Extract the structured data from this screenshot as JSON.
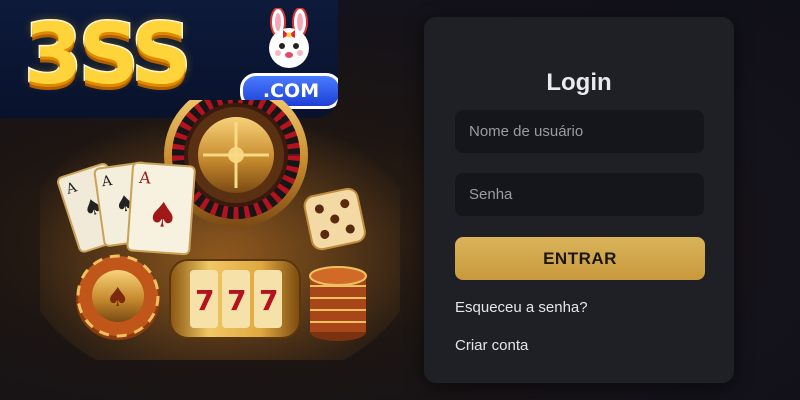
{
  "logo": {
    "brand": "3SS",
    "domain": ".COM"
  },
  "login": {
    "title": "Login",
    "username_placeholder": "Nome de usuário",
    "password_placeholder": "Senha",
    "submit_label": "ENTRAR",
    "forgot_link": "Esqueceu a senha?",
    "create_link": "Criar conta"
  },
  "illustration": {
    "slot_reels": [
      "7",
      "7",
      "7"
    ],
    "card_ranks": [
      "A",
      "A",
      "A"
    ]
  },
  "colors": {
    "accent_gold": "#d4ad52",
    "card_bg": "#1f2026",
    "field_bg": "#15161b",
    "logo_yellow": "#ffd43b",
    "logo_blue": "#2b55f0"
  }
}
